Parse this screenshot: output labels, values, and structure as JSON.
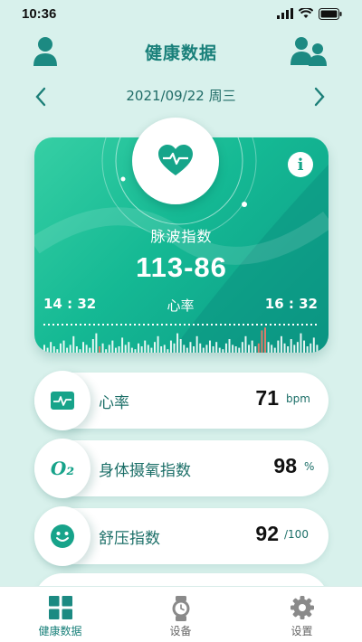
{
  "status": {
    "time": "10:36"
  },
  "header": {
    "title": "健康数据"
  },
  "date": {
    "text": "2021/09/22 周三"
  },
  "card": {
    "label": "脉波指数",
    "value": "113-86",
    "start_time": "14 : 32",
    "mid_label": "心率",
    "end_time": "16 : 32",
    "info_symbol": "i"
  },
  "metrics": [
    {
      "name": "heart-rate",
      "label": "心率",
      "value": "71",
      "unit": "bpm",
      "icon": "pulse-icon"
    },
    {
      "name": "spo2",
      "label": "身体摄氧指数",
      "value": "98",
      "unit": "%",
      "icon": "o2-icon"
    },
    {
      "name": "stress",
      "label": "舒压指数",
      "value": "92",
      "unit": "/100",
      "icon": "smile-icon"
    }
  ],
  "o2_symbol": "O₂",
  "tabs": [
    {
      "label": "健康数据",
      "icon": "grid-icon",
      "active": true
    },
    {
      "label": "设备",
      "icon": "watch-icon",
      "active": false
    },
    {
      "label": "设置",
      "icon": "gear-icon",
      "active": false
    }
  ],
  "colors": {
    "accent": "#19807a",
    "card": "#15b994",
    "highlight": "#e07a6a"
  }
}
